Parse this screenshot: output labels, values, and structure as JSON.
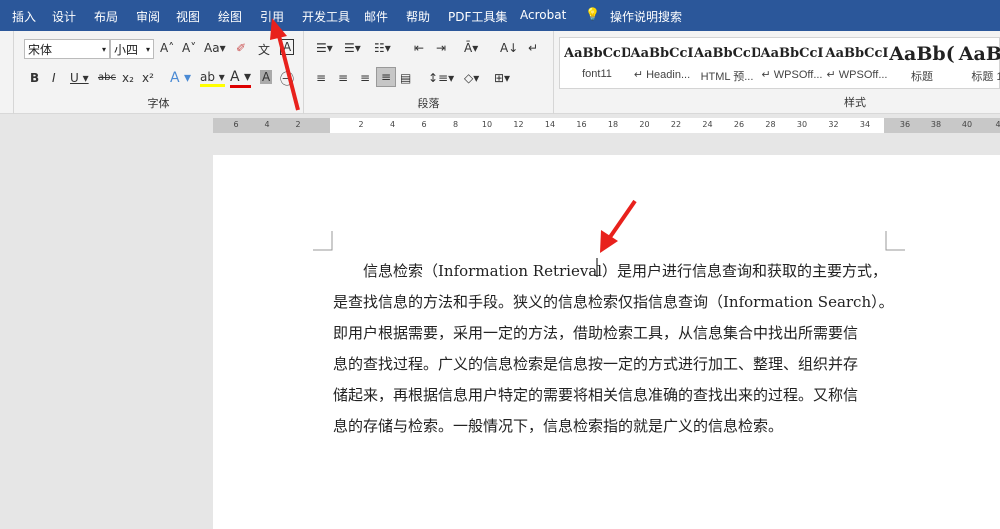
{
  "tabs": [
    "插入",
    "设计",
    "布局",
    "审阅",
    "视图",
    "绘图",
    "引用",
    "开发工具",
    "邮件",
    "帮助",
    "PDF工具集",
    "Acrobat",
    "操作说明搜索"
  ],
  "font": {
    "name": "宋体",
    "size": "小四",
    "group_label": "字体"
  },
  "paragraph": {
    "group_label": "段落"
  },
  "styles": {
    "group_label": "样式",
    "items": [
      {
        "preview": "AaBbCcDc",
        "name": "font11"
      },
      {
        "preview": "AaBbCcI",
        "name": "↵ Headin..."
      },
      {
        "preview": "AaBbCcDc",
        "name": "HTML 预..."
      },
      {
        "preview": "AaBbCcI",
        "name": "↵ WPSOff..."
      },
      {
        "preview": "AaBbCcI",
        "name": "↵ WPSOff..."
      },
      {
        "preview": "AaBb(",
        "name": "标题"
      },
      {
        "preview": "AaBb",
        "name": "标题 1"
      }
    ]
  },
  "ruler": {
    "left": [
      "6",
      "4",
      "2"
    ],
    "main": [
      "2",
      "4",
      "6",
      "8",
      "10",
      "12",
      "14",
      "16",
      "18",
      "20",
      "22",
      "24",
      "26",
      "28",
      "30",
      "32",
      "34"
    ],
    "right": [
      "36",
      "38",
      "40",
      "4"
    ]
  },
  "document": {
    "lines": [
      "　　信息检索（Information Retrieval）是用户进行信息查询和获取的主要方式，",
      "是查找信息的方法和手段。狭义的信息检索仅指信息查询（Information Search）。",
      "即用户根据需要，采用一定的方法，借助检索工具，从信息集合中找出所需要信",
      "息的查找过程。广义的信息检索是信息按一定的方式进行加工、整理、组织并存",
      "储起来，再根据信息用户特定的需要将相关信息准确的查找出来的过程。又称信",
      "息的存储与检索。一般情况下，信息检索指的就是广义的信息检索。"
    ]
  },
  "colors": {
    "tabbar": "#2b579a",
    "arrow": "#e8211c"
  }
}
